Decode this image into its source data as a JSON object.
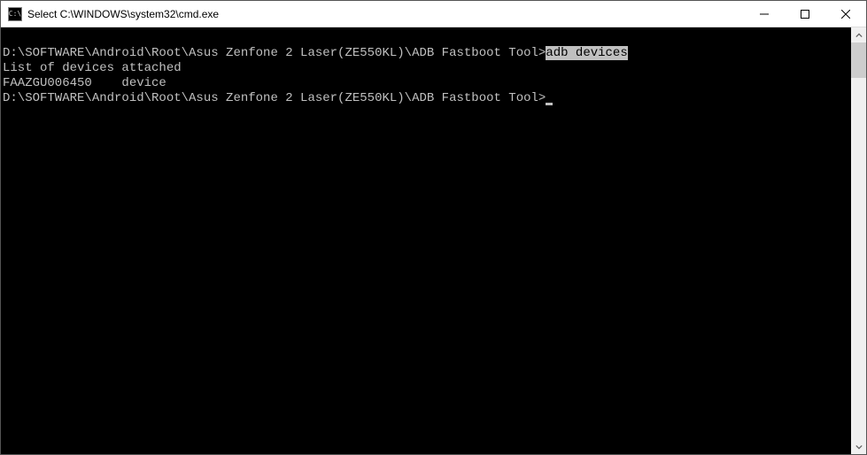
{
  "window": {
    "title": "Select C:\\WINDOWS\\system32\\cmd.exe",
    "icon_text": "C:\\"
  },
  "terminal": {
    "line1_prompt": "D:\\SOFTWARE\\Android\\Root\\Asus Zenfone 2 Laser(ZE550KL)\\ADB Fastboot Tool>",
    "line1_selected": "adb devices",
    "line2": "List of devices attached",
    "line3": "FAAZGU006450    device",
    "blank": "",
    "line4_prompt": "D:\\SOFTWARE\\Android\\Root\\Asus Zenfone 2 Laser(ZE550KL)\\ADB Fastboot Tool>"
  }
}
